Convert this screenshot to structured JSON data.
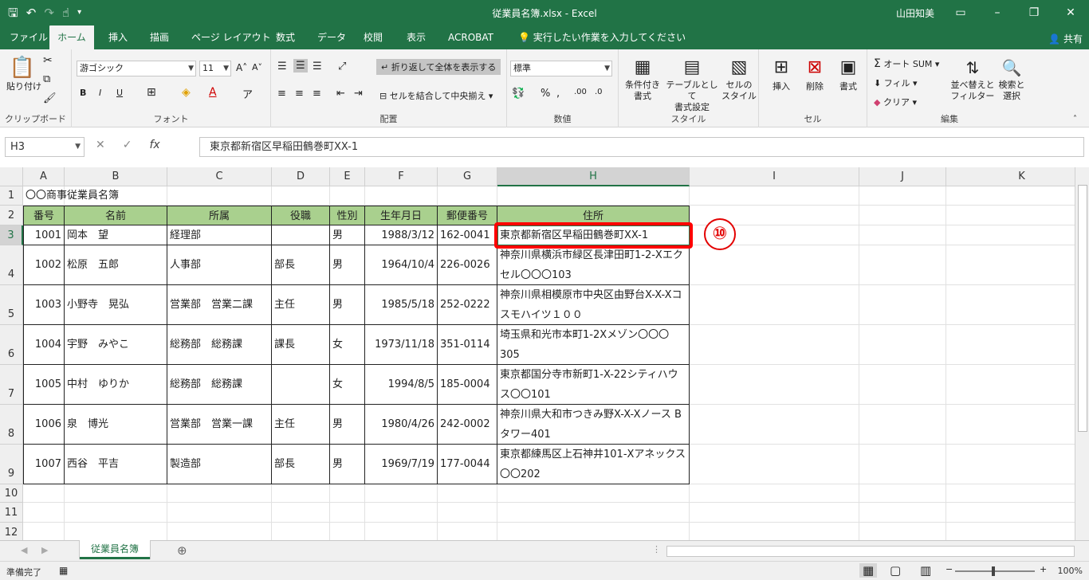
{
  "window": {
    "title": "従業員名簿.xlsx  -  Excel",
    "user": "山田知美"
  },
  "tabs": [
    "ファイル",
    "ホーム",
    "挿入",
    "描画",
    "ページ レイアウト",
    "数式",
    "データ",
    "校閲",
    "表示",
    "ACROBAT",
    "実行したい作業を入力してください"
  ],
  "share": "共有",
  "ribbon": {
    "clipboard": {
      "paste": "貼り付け",
      "label": "クリップボード"
    },
    "font": {
      "name": "游ゴシック",
      "size": "11",
      "label": "フォント",
      "bold": "B",
      "italic": "I",
      "underline": "U"
    },
    "alignment": {
      "wrap": "折り返して全体を表示する",
      "merge": "セルを結合して中央揃え",
      "label": "配置"
    },
    "number": {
      "format": "標準",
      "label": "数値"
    },
    "styles": {
      "conditional": "条件付き\n書式",
      "table": "テーブルとして\n書式設定",
      "cell": "セルの\nスタイル",
      "label": "スタイル"
    },
    "cells": {
      "insert": "挿入",
      "delete": "削除",
      "format": "書式",
      "label": "セル"
    },
    "editing": {
      "autosum": "オート SUM",
      "fill": "フィル",
      "clear": "クリア",
      "sort": "並べ替えと\nフィルター",
      "find": "検索と\n選択",
      "label": "編集"
    }
  },
  "formula_bar": {
    "name_box": "H3",
    "formula": "東京都新宿区早稲田鶴巻町XX-1"
  },
  "columns": [
    "A",
    "B",
    "C",
    "D",
    "E",
    "F",
    "G",
    "H",
    "I",
    "J",
    "K"
  ],
  "rows": [
    "1",
    "2",
    "3",
    "4",
    "5",
    "6",
    "7",
    "8",
    "9",
    "10",
    "11",
    "12"
  ],
  "sheet": {
    "title_cell": "〇〇商事従業員名簿",
    "headers": [
      "番号",
      "名前",
      "所属",
      "役職",
      "性別",
      "生年月日",
      "郵便番号",
      "住所"
    ],
    "records": [
      [
        "1001",
        "岡本　望",
        "経理部",
        "",
        "男",
        "1988/3/12",
        "162-0041",
        "東京都新宿区早稲田鶴巻町XX-1"
      ],
      [
        "1002",
        "松原　五郎",
        "人事部",
        "部長",
        "男",
        "1964/10/4",
        "226-0026",
        "神奈川県横浜市緑区長津田町1-2-Xエクセル〇〇〇103"
      ],
      [
        "1003",
        "小野寺　晃弘",
        "営業部　営業二課",
        "主任",
        "男",
        "1985/5/18",
        "252-0222",
        "神奈川県相模原市中央区由野台X-X-Xコスモハイツ１００"
      ],
      [
        "1004",
        "宇野　みやこ",
        "総務部　総務課",
        "課長",
        "女",
        "1973/11/18",
        "351-0114",
        "埼玉県和光市本町1-2Xメゾン〇〇〇305"
      ],
      [
        "1005",
        "中村　ゆりか",
        "総務部　総務課",
        "",
        "女",
        "1994/8/5",
        "185-0004",
        "東京都国分寺市新町1-X-22シティハウス〇〇101"
      ],
      [
        "1006",
        "泉　博光",
        "営業部　営業一課",
        "主任",
        "男",
        "1980/4/26",
        "242-0002",
        "神奈川県大和市つきみ野X-X-Xノース B タワー401"
      ],
      [
        "1007",
        "西谷　平吉",
        "製造部",
        "部長",
        "男",
        "1969/7/19",
        "177-0044",
        "東京都練馬区上石神井101-Xアネックス〇〇202"
      ]
    ]
  },
  "callout": "⑩",
  "sheet_tab": "従業員名簿",
  "status": {
    "ready": "準備完了",
    "zoom": "100%"
  }
}
